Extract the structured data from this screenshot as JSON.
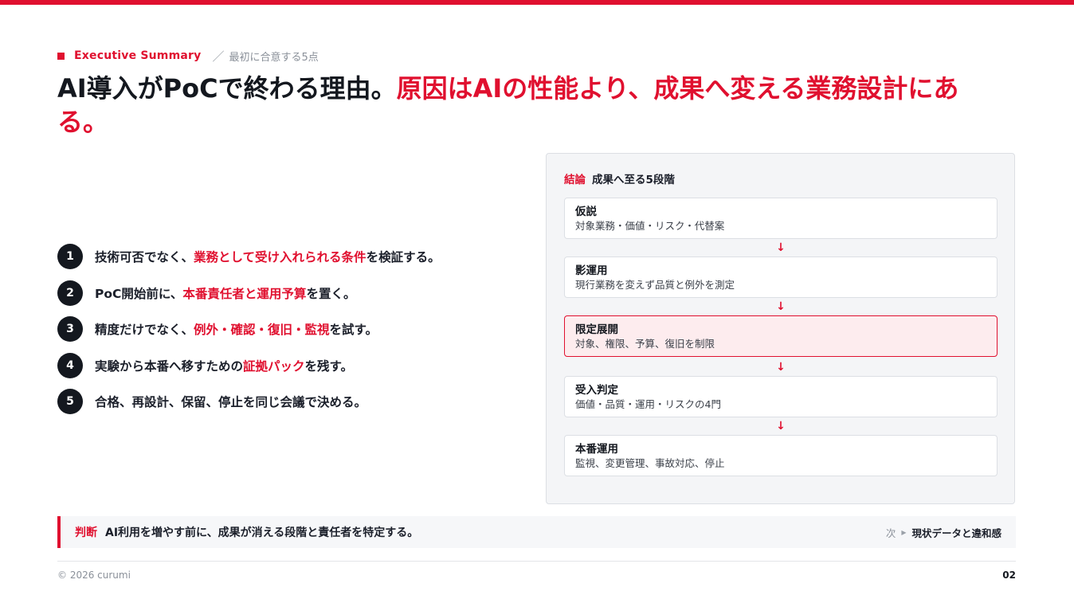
{
  "colors": {
    "accent": "#e0102f",
    "text": "#14181f",
    "muted": "#8a9099",
    "panel": "#f4f5f7"
  },
  "header": {
    "section_label": "Executive Summary",
    "separator": "／",
    "subtitle": "最初に合意する5点"
  },
  "title": {
    "part1": "AI導入がPoCで終わる理由。",
    "part2": "原因はAIの性能より、成果へ変える業務設計にある。"
  },
  "points": [
    {
      "num": "1",
      "pre": "技術可否でなく、",
      "hl": "業務として受け入れられる条件",
      "post": "を検証する。"
    },
    {
      "num": "2",
      "pre": "PoC開始前に、",
      "hl": "本番責任者と運用予算",
      "post": "を置く。"
    },
    {
      "num": "3",
      "pre": "精度だけでなく、",
      "hl": "例外・確認・復旧・監視",
      "post": "を試す。"
    },
    {
      "num": "4",
      "pre": "実験から本番へ移すための",
      "hl": "証拠パック",
      "post": "を残す。"
    },
    {
      "num": "5",
      "pre": "合格、再設計、保留、停止を同じ会議で決める。",
      "hl": "",
      "post": ""
    }
  ],
  "panel": {
    "tag": "結論",
    "heading": "成果へ至る5段階",
    "arrow": "↓",
    "steps": [
      {
        "title": "仮説",
        "desc": "対象業務・価値・リスク・代替案"
      },
      {
        "title": "影運用",
        "desc": "現行業務を変えず品質と例外を測定"
      },
      {
        "title": "限定展開",
        "desc": "対象、権限、予算、復旧を制限"
      },
      {
        "title": "受入判定",
        "desc": "価値・品質・運用・リスクの4門"
      },
      {
        "title": "本番運用",
        "desc": "監視、変更管理、事故対応、停止"
      }
    ]
  },
  "judgement": {
    "tag": "判断",
    "text": "AI利用を増やす前に、成果が消える段階と責任者を特定する。",
    "next_label": "次",
    "next_text": "現状データと違和感"
  },
  "footer": {
    "copyright": "© 2026 curumi",
    "page": "02"
  }
}
